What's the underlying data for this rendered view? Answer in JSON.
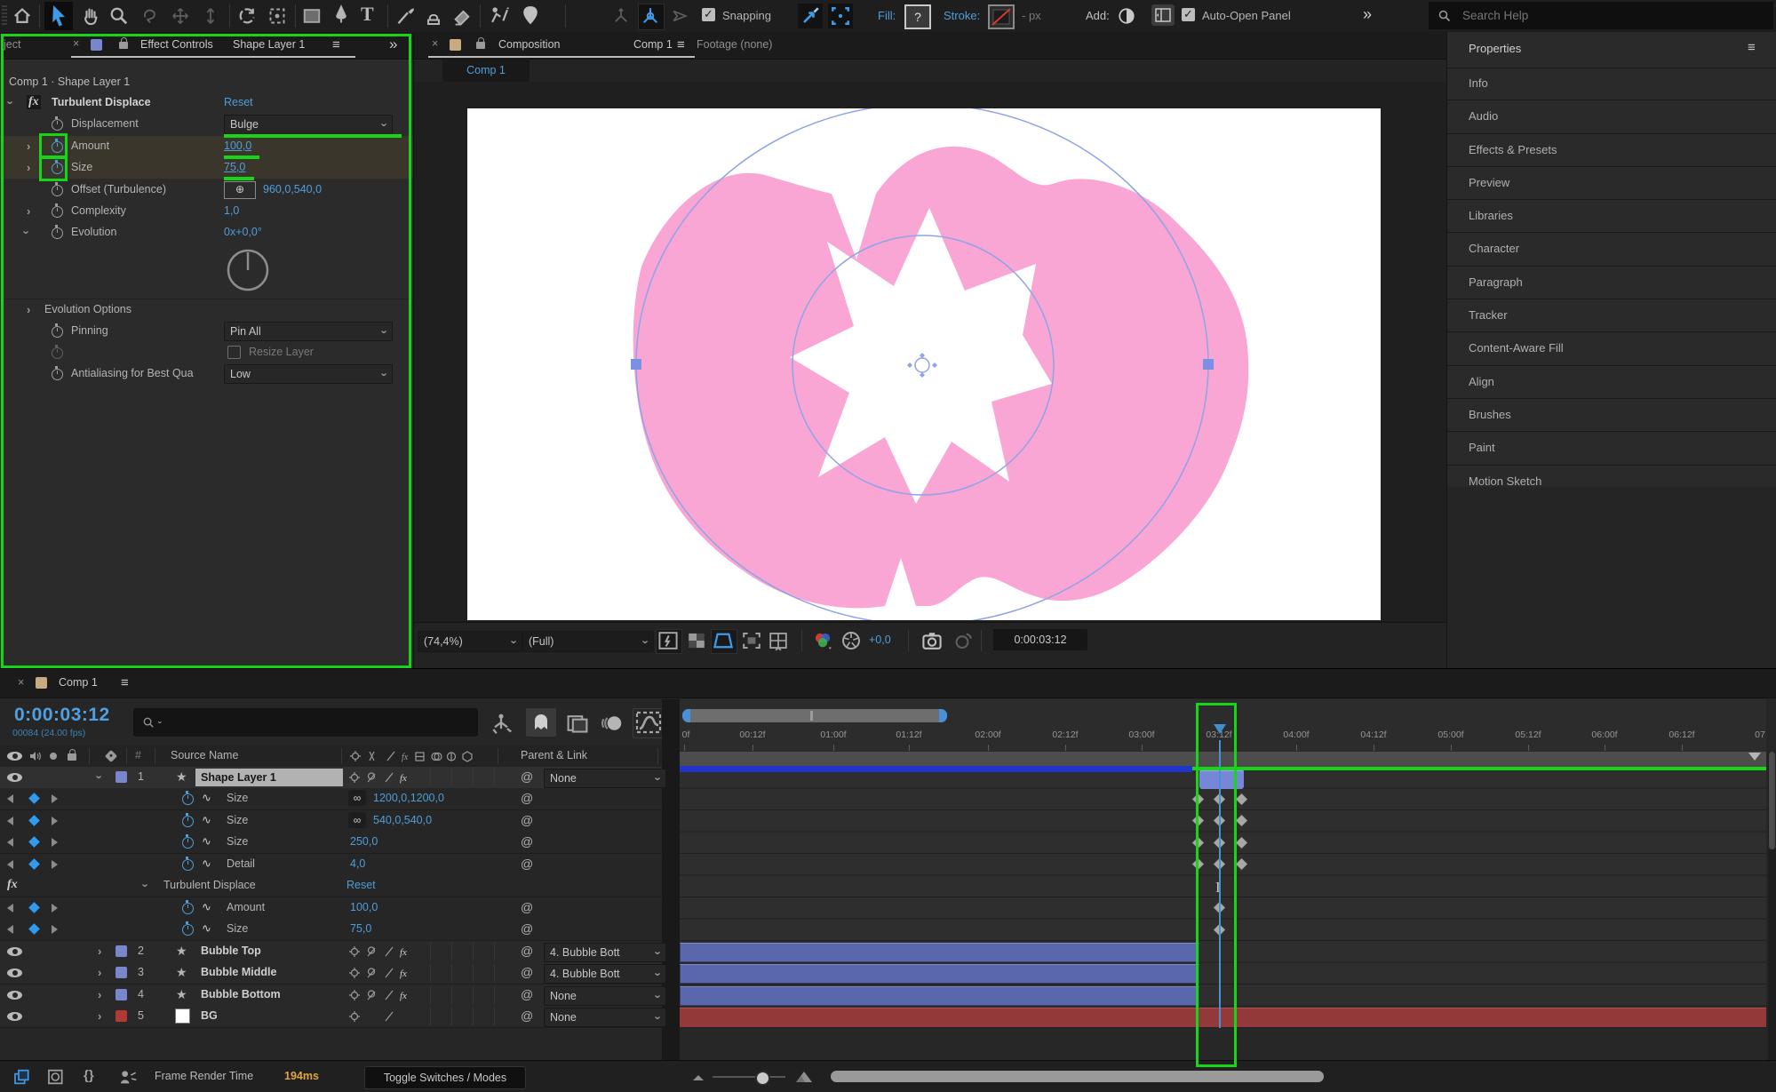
{
  "glyphs": {
    "close": "×",
    "menu": "≡",
    "overflow": "»",
    "star": "★",
    "pickwhip": "@",
    "chain": "∞",
    "graph": "∿",
    "chevron": "›",
    "crosshair": "⊕",
    "fx": "fx",
    "solo": "●",
    "ibeam": "I",
    "braces": "{}"
  },
  "colors": {
    "annotation_green": "#17d517",
    "accent_blue": "#4f9ed8",
    "shape_pink": "#f9a6d5",
    "layer_bar_blue": "#5a67ac",
    "bg_bar_red": "#94393a",
    "label_blue": "#7986cb",
    "label_red": "#b13a36",
    "selected_bar_navy": "#2135cc"
  },
  "toolbar": {
    "snapping_label": "Snapping",
    "fill_label": "Fill:",
    "fill_value": "?",
    "stroke_label": "Stroke:",
    "px_label": "- px",
    "add_label": "Add:",
    "auto_open_label": "Auto-Open Panel",
    "overflow": "»",
    "search_placeholder": "Search Help",
    "tools": [
      "home",
      "selection",
      "hand",
      "zoom",
      "rotate-behind",
      "pan",
      "vertical",
      "rotation",
      "camera",
      "rectangle",
      "pen",
      "type",
      "brush",
      "stamp",
      "eraser",
      "roto-brush",
      "puppet-pin",
      "local-axis",
      "world-axis",
      "view-axis"
    ]
  },
  "effect_controls": {
    "tab_partial": "ject",
    "tab_title": "Effect Controls",
    "tab_target": "Shape Layer 1",
    "context": "Comp 1 · Shape Layer 1",
    "effect_name": "Turbulent Displace",
    "reset": "Reset",
    "displacement_label": "Displacement",
    "displacement_value": "Bulge",
    "amount_label": "Amount",
    "amount_value": "100,0",
    "size_label": "Size",
    "size_value": "75,0",
    "offset_label": "Offset (Turbulence)",
    "offset_value": "960,0,540,0",
    "complexity_label": "Complexity",
    "complexity_value": "1,0",
    "evolution_label": "Evolution",
    "evolution_value": "0x+0,0°",
    "evolution_options_label": "Evolution Options",
    "pinning_label": "Pinning",
    "pinning_value": "Pin All",
    "resize_label": "Resize Layer",
    "aa_label": "Antialiasing for Best Qua",
    "aa_value": "Low"
  },
  "composition": {
    "tab_title": "Composition",
    "tab_target": "Comp 1",
    "footage_tab": "Footage (none)",
    "viewer_tab": "Comp 1",
    "zoom_level": "(74,4%)",
    "resolution": "(Full)",
    "exposure": "+0,0",
    "timecode": "0:00:03:12"
  },
  "properties_panel": {
    "title": "Properties",
    "items": [
      "Info",
      "Audio",
      "Effects & Presets",
      "Preview",
      "Libraries",
      "Character",
      "Paragraph",
      "Tracker",
      "Content-Aware Fill",
      "Align",
      "Brushes",
      "Paint",
      "Motion Sketch"
    ]
  },
  "timeline": {
    "tab": "Comp 1",
    "current_time": "0:00:03:12",
    "frame_info": "00084 (24.00 fps)",
    "columns": {
      "hash": "#",
      "source_name": "Source Name",
      "parent_link": "Parent & Link"
    },
    "ruler": [
      "0f",
      "00:12f",
      "01:00f",
      "01:12f",
      "02:00f",
      "02:12f",
      "03:00f",
      "03:12f",
      "04:00f",
      "04:12f",
      "05:00f",
      "05:12f",
      "06:00f",
      "06:12f",
      "07"
    ],
    "rows": [
      {
        "type": "layer",
        "num": "1",
        "name": "Shape Layer 1",
        "parent": "None"
      },
      {
        "type": "prop",
        "label": "Size",
        "value": "1200,0,1200,0"
      },
      {
        "type": "prop",
        "label": "Size",
        "value": "540,0,540,0"
      },
      {
        "type": "prop",
        "label": "Size",
        "value": "250,0"
      },
      {
        "type": "prop",
        "label": "Detail",
        "value": "4,0"
      },
      {
        "type": "effect",
        "name": "Turbulent Displace",
        "action": "Reset"
      },
      {
        "type": "prop",
        "label": "Amount",
        "value": "100,0"
      },
      {
        "type": "prop",
        "label": "Size",
        "value": "75,0"
      },
      {
        "type": "layer",
        "num": "2",
        "name": "Bubble Top",
        "parent": "4. Bubble Bott"
      },
      {
        "type": "layer",
        "num": "3",
        "name": "Bubble Middle",
        "parent": "4. Bubble Bott"
      },
      {
        "type": "layer",
        "num": "4",
        "name": "Bubble Bottom",
        "parent": "None"
      },
      {
        "type": "layer",
        "num": "5",
        "name": "BG",
        "parent": "None"
      }
    ],
    "footer": {
      "render_label": "Frame Render Time",
      "render_value": "194ms",
      "toggle_switches": "Toggle Switches / Modes"
    }
  }
}
